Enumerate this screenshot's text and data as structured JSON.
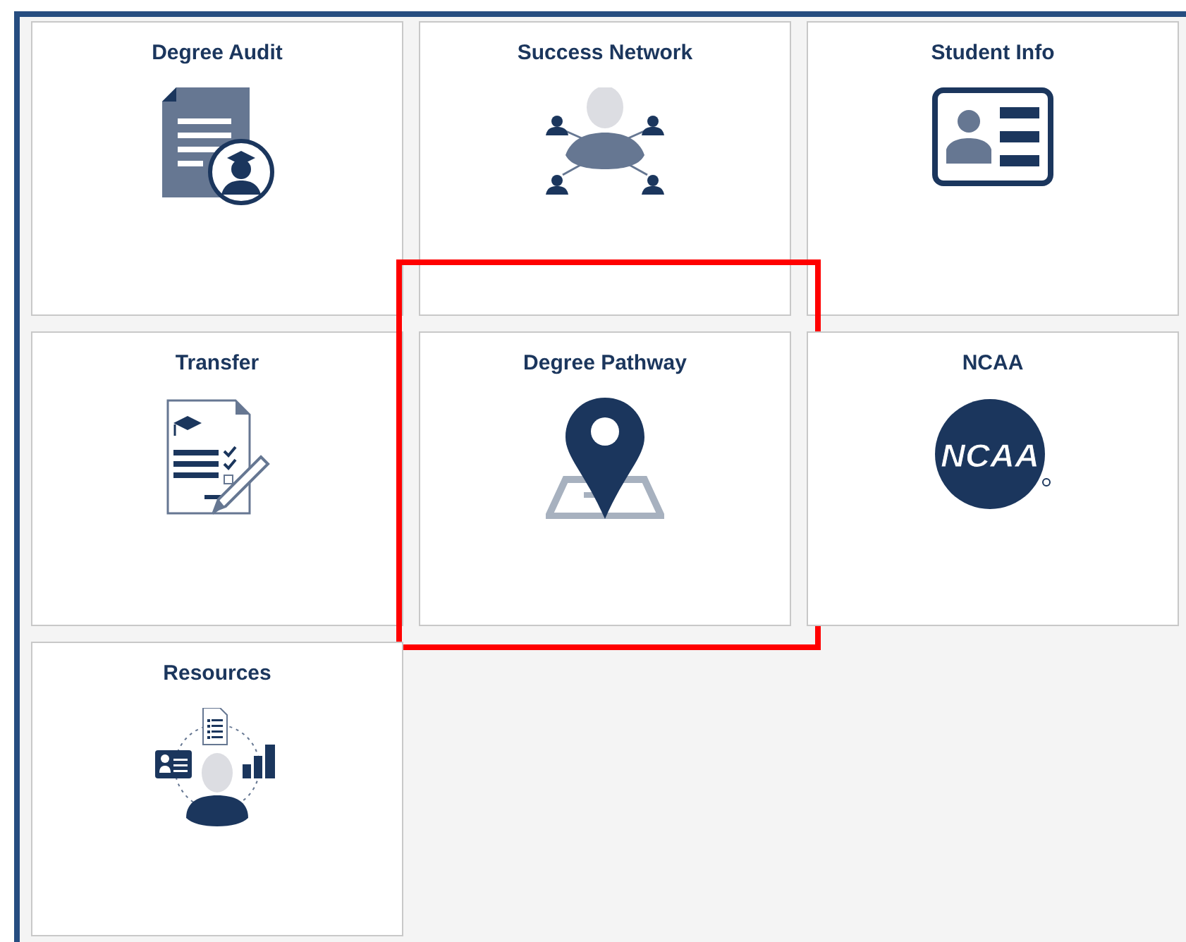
{
  "tiles": [
    {
      "title": "Degree Audit",
      "kind": "audit",
      "highlighted": false
    },
    {
      "title": "Success Network",
      "kind": "network",
      "highlighted": false
    },
    {
      "title": "Student Info",
      "kind": "id-card",
      "highlighted": false
    },
    {
      "title": "Transfer",
      "kind": "checklist",
      "highlighted": false
    },
    {
      "title": "Degree Pathway",
      "kind": "map-pin",
      "highlighted": true
    },
    {
      "title": "NCAA",
      "kind": "logo",
      "logo_text": "NCAA",
      "highlighted": false
    },
    {
      "title": "Resources",
      "kind": "resources",
      "highlighted": false
    }
  ]
}
